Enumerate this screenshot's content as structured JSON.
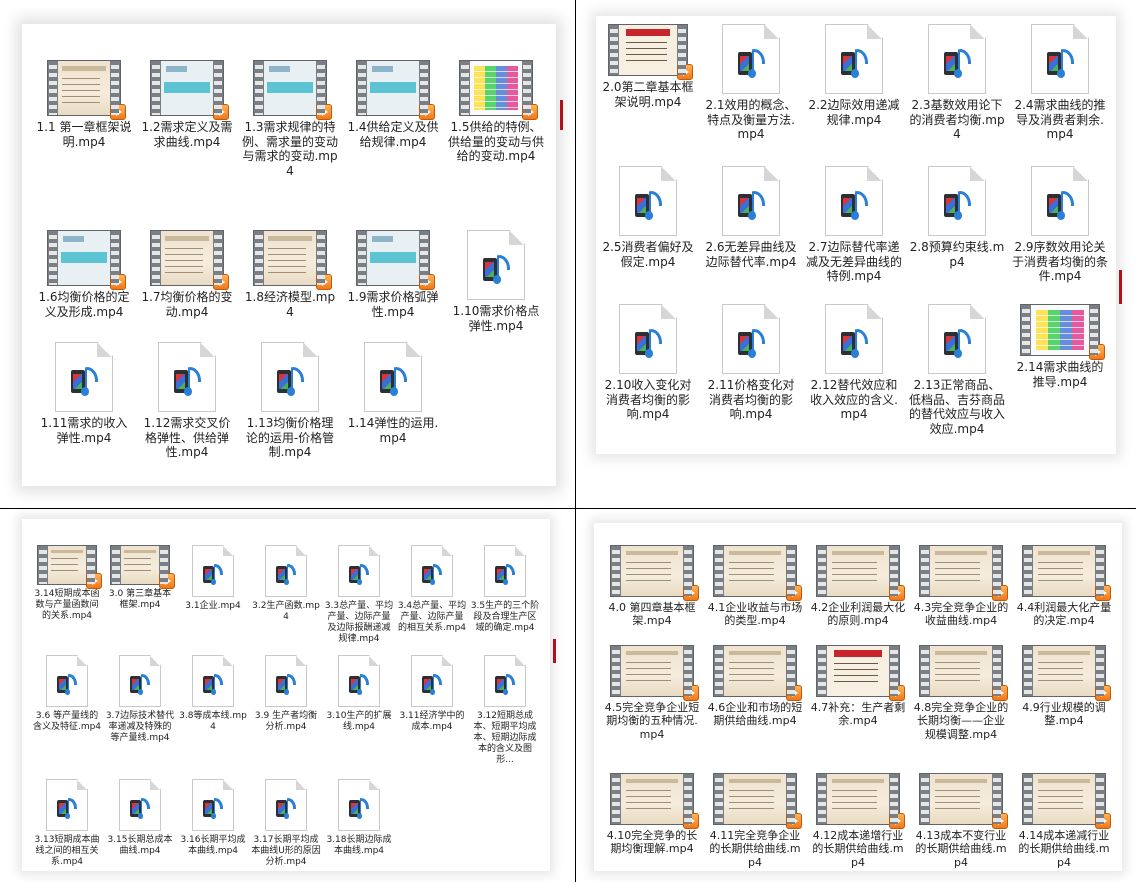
{
  "chapter1": [
    {
      "label": "1.1 第一章框架说明.mp4",
      "kind": "video",
      "screen": "scr-parch"
    },
    {
      "label": "1.2需求定义及需求曲线.mp4",
      "kind": "video",
      "screen": "scr-diag"
    },
    {
      "label": "1.3需求规律的特例、需求量的变动与需求的变动.mp4",
      "kind": "video",
      "screen": "scr-diag"
    },
    {
      "label": "1.4供给定义及供给规律.mp4",
      "kind": "video",
      "screen": "scr-diag"
    },
    {
      "label": "1.5供给的特例、供给量的变动与供给的变动.mp4",
      "kind": "video",
      "screen": "scr-table"
    },
    {
      "label": "1.6均衡价格的定义及形成.mp4",
      "kind": "video",
      "screen": "scr-diag"
    },
    {
      "label": "1.7均衡价格的变动.mp4",
      "kind": "video",
      "screen": "scr-parch"
    },
    {
      "label": "1.8经济模型.mp4",
      "kind": "video",
      "screen": "scr-parch"
    },
    {
      "label": "1.9需求价格弧弹性.mp4",
      "kind": "video",
      "screen": "scr-diag"
    },
    {
      "label": "1.10需求价格点弹性.mp4",
      "kind": "file"
    },
    {
      "label": "1.11需求的收入弹性.mp4",
      "kind": "file"
    },
    {
      "label": "1.12需求交叉价格弹性、供给弹性.mp4",
      "kind": "file"
    },
    {
      "label": "1.13均衡价格理论的运用-价格管制.mp4",
      "kind": "file"
    },
    {
      "label": "1.14弹性的运用.mp4",
      "kind": "file"
    }
  ],
  "chapter2": [
    {
      "label": "2.0第二章基本框架说明.mp4",
      "kind": "video",
      "screen": "scr-red"
    },
    {
      "label": "2.1效用的概念、特点及衡量方法.mp4",
      "kind": "file"
    },
    {
      "label": "2.2边际效用递减规律.mp4",
      "kind": "file"
    },
    {
      "label": "2.3基数效用论下的消费者均衡.mp4",
      "kind": "file"
    },
    {
      "label": "2.4需求曲线的推导及消费者剩余.mp4",
      "kind": "file"
    },
    {
      "label": "2.5消费者偏好及假定.mp4",
      "kind": "file"
    },
    {
      "label": "2.6无差异曲线及边际替代率.mp4",
      "kind": "file"
    },
    {
      "label": "2.7边际替代率递减及无差异曲线的特例.mp4",
      "kind": "file"
    },
    {
      "label": "2.8预算约束线.mp4",
      "kind": "file"
    },
    {
      "label": "2.9序数效用论关于消费者均衡的条件.mp4",
      "kind": "file"
    },
    {
      "label": "2.10收入变化对消费者均衡的影响.mp4",
      "kind": "file"
    },
    {
      "label": "2.11价格变化对消费者均衡的影响.mp4",
      "kind": "file"
    },
    {
      "label": "2.12替代效应和收入效应的含义.mp4",
      "kind": "file"
    },
    {
      "label": "2.13正常商品、低档品、吉芬商品的替代效应与收入效应.mp4",
      "kind": "file"
    },
    {
      "label": "2.14需求曲线的推导.mp4",
      "kind": "video",
      "screen": "scr-table"
    }
  ],
  "chapter3": [
    {
      "label": "3.14短期成本函数与产量函数间的关系.mp4",
      "kind": "video",
      "screen": "scr-parch"
    },
    {
      "label": "3.0 第三章基本框架.mp4",
      "kind": "video",
      "screen": "scr-parch"
    },
    {
      "label": "3.1企业.mp4",
      "kind": "file"
    },
    {
      "label": "3.2生产函数.mp4",
      "kind": "file"
    },
    {
      "label": "3.3总产量、平均产量、边际产量及边际报酬递减规律.mp4",
      "kind": "file"
    },
    {
      "label": "3.4总产量、平均产量、边际产量的相互关系.mp4",
      "kind": "file"
    },
    {
      "label": "3.5生产的三个阶段及合理生产区域的确定.mp4",
      "kind": "file"
    },
    {
      "label": "3.6 等产量线的含义及特征.mp4",
      "kind": "file"
    },
    {
      "label": "3.7边际技术替代率递减及特殊的等产量线.mp4",
      "kind": "file"
    },
    {
      "label": "3.8等成本线.mp4",
      "kind": "file"
    },
    {
      "label": "3.9 生产者均衡分析.mp4",
      "kind": "file"
    },
    {
      "label": "3.10生产的扩展线.mp4",
      "kind": "file"
    },
    {
      "label": "3.11经济学中的成本.mp4",
      "kind": "file"
    },
    {
      "label": "3.12短期总成本、短期平均成本、短期边际成本的含义及图形...",
      "kind": "file"
    },
    {
      "label": "3.13短期成本曲线之间的相互关系.mp4",
      "kind": "file"
    },
    {
      "label": "3.15长期总成本曲线.mp4",
      "kind": "file"
    },
    {
      "label": "3.16长期平均成本曲线.mp4",
      "kind": "file"
    },
    {
      "label": "3.17长期平均成本曲线U形的原因分析.mp4",
      "kind": "file"
    },
    {
      "label": "3.18长期边际成本曲线.mp4",
      "kind": "file"
    }
  ],
  "chapter4": [
    {
      "label": "4.0 第四章基本框架.mp4",
      "kind": "video",
      "screen": "scr-parch"
    },
    {
      "label": "4.1企业收益与市场的类型.mp4",
      "kind": "video",
      "screen": "scr-parch"
    },
    {
      "label": "4.2企业利润最大化的原则.mp4",
      "kind": "video",
      "screen": "scr-parch"
    },
    {
      "label": "4.3完全竞争企业的收益曲线.mp4",
      "kind": "video",
      "screen": "scr-parch"
    },
    {
      "label": "4.4利润最大化产量的决定.mp4",
      "kind": "video",
      "screen": "scr-parch"
    },
    {
      "label": "4.5完全竞争企业短期均衡的五种情况.mp4",
      "kind": "video",
      "screen": "scr-parch"
    },
    {
      "label": "4.6企业和市场的短期供给曲线.mp4",
      "kind": "video",
      "screen": "scr-parch"
    },
    {
      "label": "4.7补充：生产者剩余.mp4",
      "kind": "video",
      "screen": "scr-red"
    },
    {
      "label": "4.8完全竞争企业的长期均衡——企业规模调整.mp4",
      "kind": "video",
      "screen": "scr-parch"
    },
    {
      "label": "4.9行业规模的调整.mp4",
      "kind": "video",
      "screen": "scr-parch"
    },
    {
      "label": "4.10完全竞争的长期均衡理解.mp4",
      "kind": "video",
      "screen": "scr-parch"
    },
    {
      "label": "4.11完全竞争企业的长期供给曲线.mp4",
      "kind": "video",
      "screen": "scr-parch"
    },
    {
      "label": "4.12成本递增行业的长期供给曲线.mp4",
      "kind": "video",
      "screen": "scr-parch"
    },
    {
      "label": "4.13成本不变行业的长期供给曲线.mp4",
      "kind": "video",
      "screen": "scr-parch"
    },
    {
      "label": "4.14成本递减行业的长期供给曲线.mp4",
      "kind": "video",
      "screen": "scr-parch"
    }
  ]
}
